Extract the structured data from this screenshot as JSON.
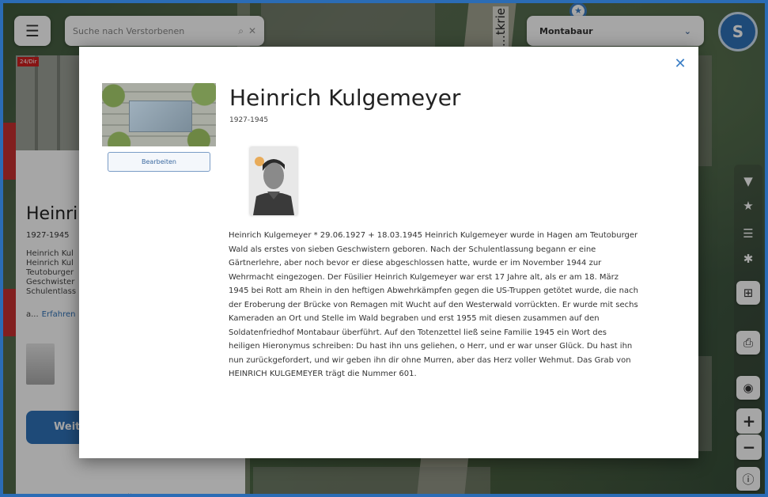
{
  "map": {
    "street_label": "…tkrie"
  },
  "topbar": {
    "menu_icon": "hamburger-icon",
    "search_placeholder": "Suche nach Verstorbenen",
    "search_icon": "search-icon",
    "clear_icon": "close-icon",
    "city": "Montabaur",
    "avatar_letter": "S"
  },
  "side_panel": {
    "name": "Heinri",
    "years": "1927-1945",
    "text_lines": [
      "Heinrich Kul",
      "Heinrich Kul",
      "Teutoburger",
      "Geschwister",
      "Schulentlass"
    ],
    "more_prefix": "a...",
    "more_link": "Erfahren",
    "button_label": "Weit",
    "tag_label": "24/Dir"
  },
  "toolbar": {
    "filter_icon": "filter-icon",
    "star_icon": "star-icon",
    "list_icon": "list-icon",
    "gear_icon": "gear-icon",
    "add_icon": "add-icon",
    "print_icon": "print-icon",
    "locate_icon": "locate-icon",
    "zoom_in": "+",
    "zoom_out": "−",
    "info_icon": "info-icon"
  },
  "modal": {
    "close_icon": "close-icon",
    "edit_label": "Bearbeiten",
    "name": "Heinrich Kulgemeyer",
    "years": "1927-1945",
    "bio": "Heinrich Kulgemeyer * 29.06.1927 + 18.03.1945 Heinrich Kulgemeyer wurde in Hagen am Teutoburger Wald als erstes von sieben Geschwistern geboren. Nach der Schulentlassung begann er eine Gärtnerlehre, aber noch bevor er diese abgeschlossen hatte, wurde er im November 1944 zur Wehrmacht eingezogen. Der Füsilier Heinrich Kulgemeyer war erst 17 Jahre alt, als er am 18. März 1945 bei Rott am Rhein in den heftigen Abwehrkämpfen gegen die US-Truppen getötet wurde, die nach der Eroberung der Brücke von Remagen mit Wucht auf den Westerwald vorrückten. Er wurde mit sechs Kameraden an Ort und Stelle im Wald begraben und erst 1955 mit diesen zusammen auf den Soldatenfriedhof Montabaur überführt. Auf den Totenzettel ließ seine Familie 1945 ein Wort des heiligen Hieronymus schreiben: Du hast ihn uns geliehen, o Herr, und er war unser Glück. Du hast ihn nun zurückgefordert, und wir geben ihn dir ohne Murren, aber das Herz voller Wehmut. Das Grab von HEINRICH KULGEMEYER trägt die Nummer 601."
  },
  "colors": {
    "accent": "#2f72b8",
    "close": "#3c7fc6",
    "tag_red": "#d02020"
  }
}
